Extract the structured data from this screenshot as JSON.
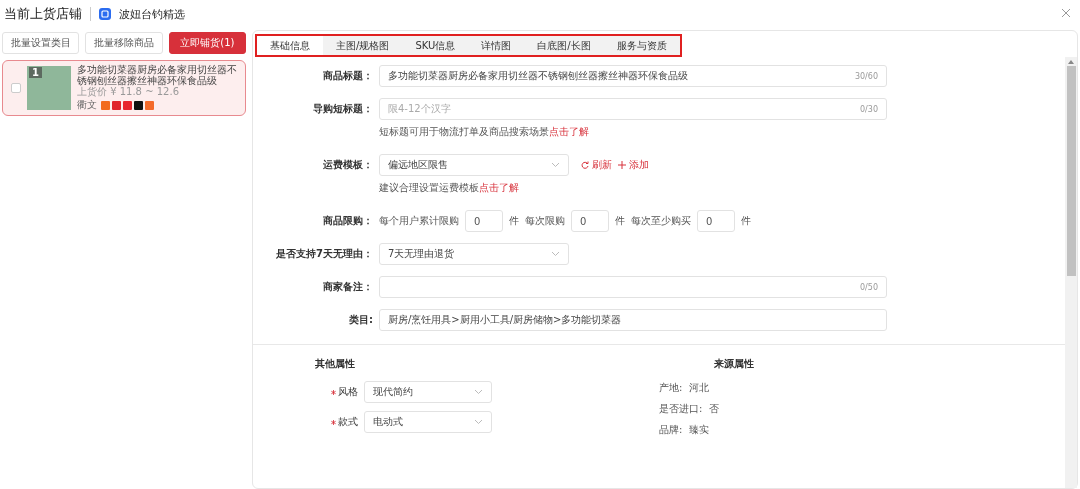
{
  "header": {
    "title": "当前上货店铺",
    "shop": "波妞台钓精选"
  },
  "actions": [
    {
      "label": "批量设置类目",
      "kind": "plain"
    },
    {
      "label": "批量移除商品",
      "kind": "plain"
    },
    {
      "label": "立即铺货(1)",
      "kind": "primary"
    }
  ],
  "products": [
    {
      "index": "1",
      "title": "多功能切菜器厨房必备家用切丝器不锈钢刨丝器擦丝神器环保食品级",
      "price": "上货价 ¥ 11.8 ~ 12.6",
      "source": "衢文",
      "checked": false,
      "selected": true
    }
  ],
  "tabs": [
    {
      "label": "基础信息",
      "selected": true
    },
    {
      "label": "主图/规格图",
      "selected": false
    },
    {
      "label": "SKU信息",
      "selected": false
    },
    {
      "label": "详情图",
      "selected": false
    },
    {
      "label": "白底图/长图",
      "selected": false
    },
    {
      "label": "服务与资质",
      "selected": false
    }
  ],
  "form": {
    "title": {
      "label": "商品标题：",
      "value": "多功能切菜器厨房必备家用切丝器不锈钢刨丝器擦丝神器环保食品级",
      "count": "30/60"
    },
    "short_title": {
      "label": "导购短标题：",
      "placeholder": "限4-12个汉字",
      "count": "0/30",
      "hint": "短标题可用于物流打单及商品搜索场景",
      "hint_link": "点击了解"
    },
    "shipping": {
      "label": "运费模板：",
      "value": "偏远地区限售",
      "refresh": "刷新",
      "add": "添加",
      "hint": "建议合理设置运费模板",
      "hint_link": "点击了解"
    },
    "limit": {
      "label": "商品限购：",
      "items": [
        {
          "prefix": "每个用户累计限购",
          "value": "0",
          "unit": "件"
        },
        {
          "prefix": "每次限购",
          "value": "0",
          "unit": "件"
        },
        {
          "prefix": "每次至少购买",
          "value": "0",
          "unit": "件"
        }
      ]
    },
    "return": {
      "label": "是否支持7天无理由：",
      "value": "7天无理由退货"
    },
    "note": {
      "label": "商家备注：",
      "count": "0/50"
    },
    "category": {
      "label": "类目:",
      "value": "厨房/烹饪用具>厨用小工具/厨房储物>多功能切菜器"
    }
  },
  "other_attrs": {
    "title": "其他属性",
    "items": [
      {
        "label": "风格",
        "value": "现代简约",
        "required": true
      },
      {
        "label": "款式",
        "value": "电动式",
        "required": true
      }
    ]
  },
  "source_attrs": {
    "title": "来源属性",
    "items": [
      {
        "label": "产地:",
        "value": "河北"
      },
      {
        "label": "是否进口:",
        "value": "否"
      },
      {
        "label": "品牌:",
        "value": "臻实"
      }
    ]
  }
}
